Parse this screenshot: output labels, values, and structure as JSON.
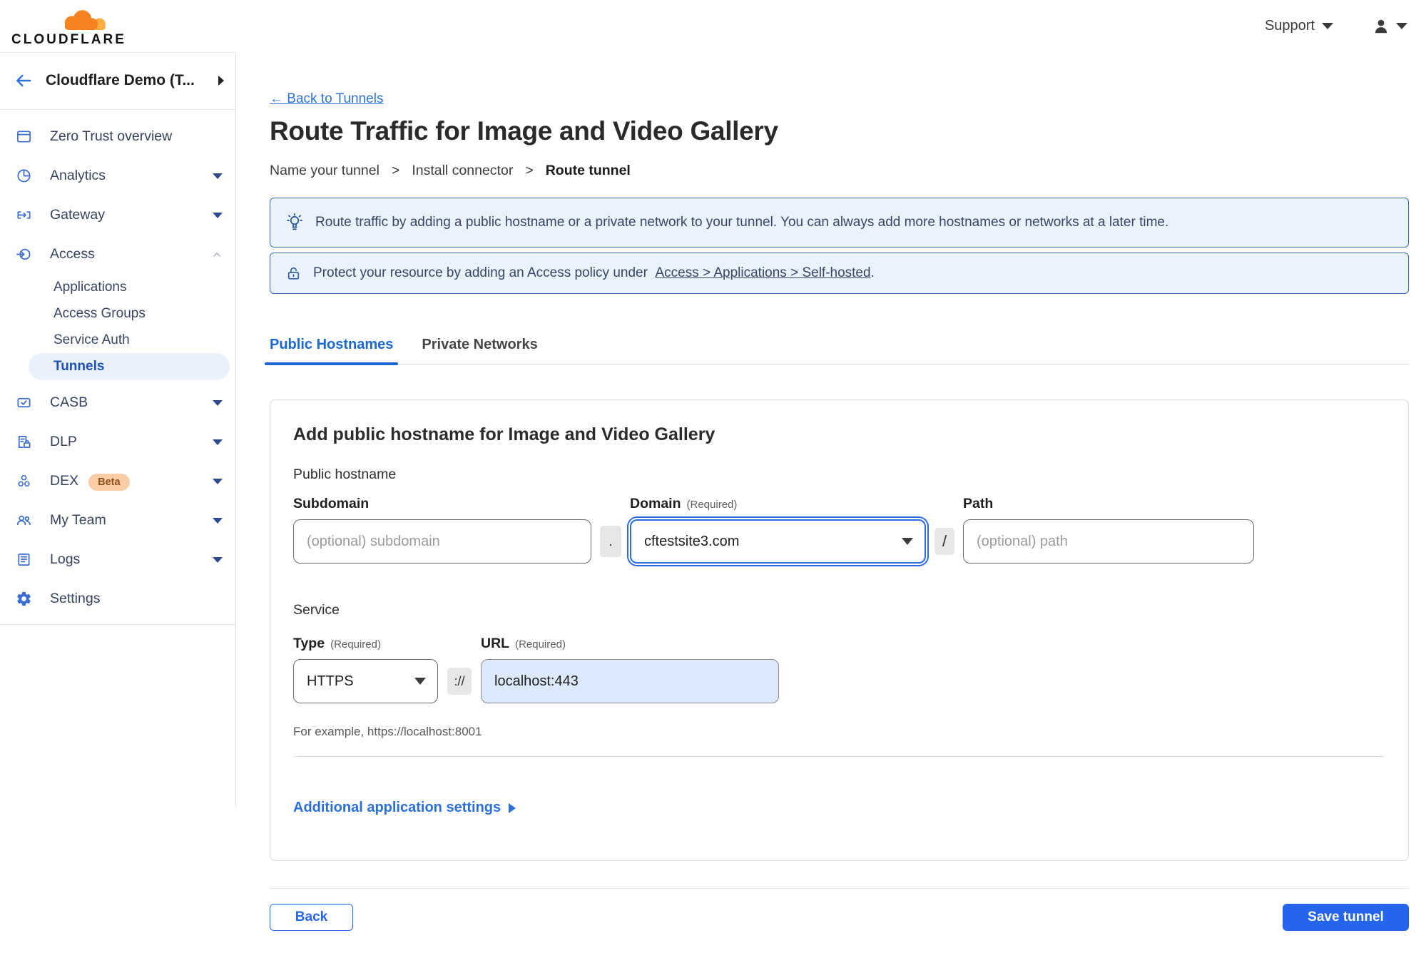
{
  "topbar": {
    "logo_text": "CLOUDFLARE",
    "support_label": "Support"
  },
  "sidebar": {
    "account_label": "Cloudflare Demo (T...",
    "items": [
      {
        "label": "Zero Trust overview",
        "icon": "overview-icon"
      },
      {
        "label": "Analytics",
        "icon": "analytics-icon"
      },
      {
        "label": "Gateway",
        "icon": "gateway-icon"
      },
      {
        "label": "Access",
        "icon": "access-icon"
      },
      {
        "label": "Applications"
      },
      {
        "label": "Access Groups"
      },
      {
        "label": "Service Auth"
      },
      {
        "label": "Tunnels"
      },
      {
        "label": "CASB",
        "icon": "casb-icon"
      },
      {
        "label": "DLP",
        "icon": "dlp-icon"
      },
      {
        "label": "DEX",
        "icon": "dex-icon",
        "badge": "Beta"
      },
      {
        "label": "My Team",
        "icon": "my-team-icon"
      },
      {
        "label": "Logs",
        "icon": "logs-icon"
      },
      {
        "label": "Settings",
        "icon": "settings-icon"
      }
    ]
  },
  "main": {
    "back_link_label": "← Back to Tunnels",
    "title": "Route Traffic for Image and Video Gallery",
    "steps": [
      "Name your tunnel",
      "Install connector",
      "Route tunnel"
    ],
    "step_separator": ">",
    "banners": {
      "info_text": "Route traffic by adding a public hostname or a private network to your tunnel. You can always add more hostnames or networks at a later time.",
      "protect_prefix": "Protect your resource by adding an Access policy under",
      "protect_link": "Access > Applications > Self-hosted",
      "protect_suffix": "."
    },
    "tabs": {
      "public_hostnames": "Public Hostnames",
      "private_networks": "Private Networks"
    },
    "form": {
      "heading": "Add public hostname for Image and Video Gallery",
      "public_hostname_label": "Public hostname",
      "subdomain_label": "Subdomain",
      "subdomain_placeholder": "(optional) subdomain",
      "domain_label": "Domain",
      "domain_required": "(Required)",
      "domain_value": "cftestsite3.com",
      "dot_separator": ".",
      "slash_separator": "/",
      "path_label": "Path",
      "path_placeholder": "(optional) path",
      "service_label": "Service",
      "type_label": "Type",
      "type_required": "(Required)",
      "type_value": "HTTPS",
      "url_label": "URL",
      "url_required": "(Required)",
      "url_scheme_separator": "://",
      "url_value": "localhost:443",
      "example_text": "For example, https://localhost:8001",
      "additional_settings_label": "Additional application settings"
    },
    "footer": {
      "back_label": "Back",
      "save_label": "Save tunnel"
    }
  },
  "colors": {
    "accent_blue": "#2565ec",
    "link_blue": "#2e72d2",
    "tab_active_blue": "#1a66d0",
    "sidebar_icon_blue": "#3b6dcc",
    "active_item_bg": "#e8f1fc",
    "active_item_text": "#1d50b5",
    "banner_bg": "#eaf2fb",
    "banner_border": "#3a6db8",
    "beta_badge_bg": "#f9cda6",
    "beta_badge_text": "#8f4f1d",
    "url_value_bg": "#dce8fb"
  }
}
